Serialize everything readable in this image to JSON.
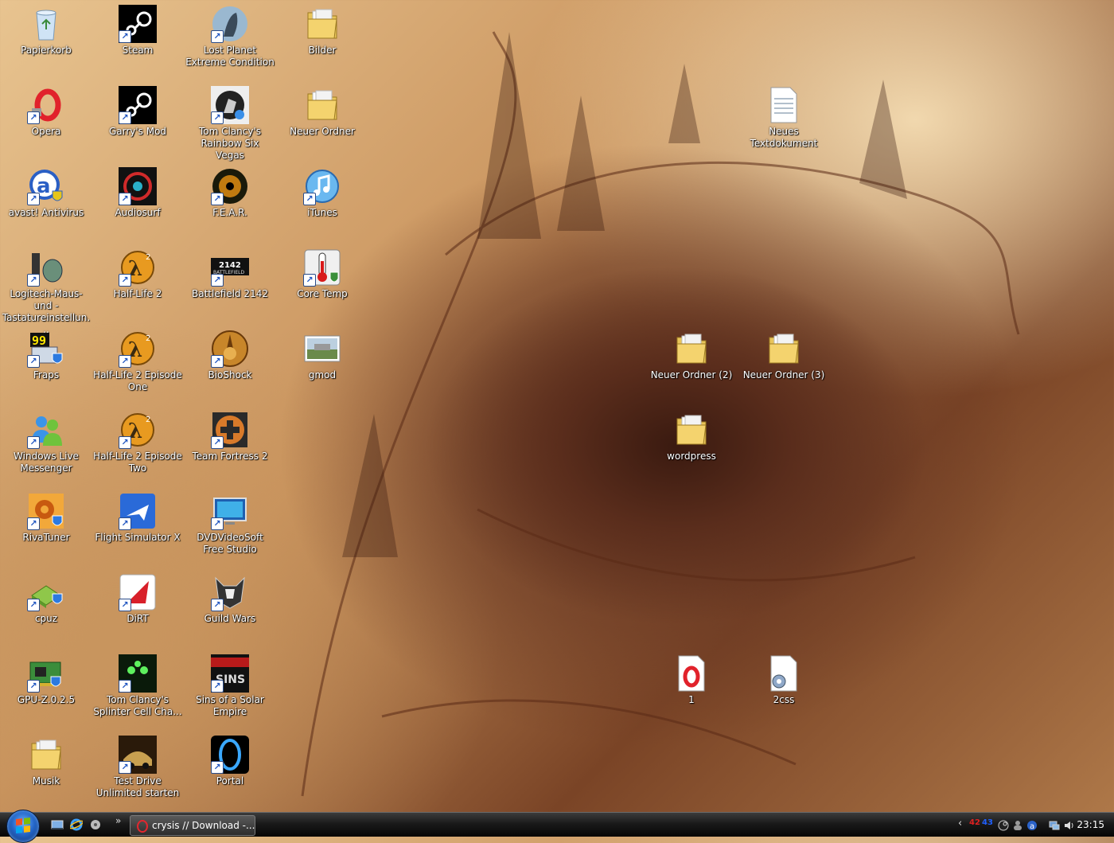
{
  "desktop": {
    "col1": [
      {
        "label": "Papierkorb",
        "icon": "recycle-bin-icon",
        "shortcut": false
      },
      {
        "label": "Opera",
        "icon": "opera-icon",
        "shortcut": true
      },
      {
        "label": "avast! Antivirus",
        "icon": "avast-icon",
        "shortcut": true
      },
      {
        "label": "Logitech-Maus- und -Tastatureinstellun...",
        "icon": "logitech-icon",
        "shortcut": true
      },
      {
        "label": "Fraps",
        "icon": "fraps-icon",
        "shortcut": true
      },
      {
        "label": "Windows Live Messenger",
        "icon": "messenger-icon",
        "shortcut": true
      },
      {
        "label": "RivaTuner",
        "icon": "rivatuner-icon",
        "shortcut": true
      },
      {
        "label": "cpuz",
        "icon": "cpuz-icon",
        "shortcut": true
      },
      {
        "label": "GPU-Z.0.2.5",
        "icon": "gpuz-icon",
        "shortcut": true
      },
      {
        "label": "Musik",
        "icon": "folder-icon",
        "shortcut": false
      }
    ],
    "col2": [
      {
        "label": "Steam",
        "icon": "steam-icon",
        "shortcut": true
      },
      {
        "label": "Garry's Mod",
        "icon": "steam-icon",
        "shortcut": true
      },
      {
        "label": "Audiosurf",
        "icon": "audiosurf-icon",
        "shortcut": true
      },
      {
        "label": "Half-Life 2",
        "icon": "halflife-icon",
        "shortcut": true
      },
      {
        "label": "Half-Life 2 Episode One",
        "icon": "halflife-icon",
        "shortcut": true
      },
      {
        "label": "Half-Life 2 Episode Two",
        "icon": "halflife-icon",
        "shortcut": true
      },
      {
        "label": "Flight Simulator X",
        "icon": "flightsim-icon",
        "shortcut": true
      },
      {
        "label": "DiRT",
        "icon": "dirt-icon",
        "shortcut": true
      },
      {
        "label": "Tom Clancy's Splinter Cell Cha...",
        "icon": "splintercell-icon",
        "shortcut": true
      },
      {
        "label": "Test Drive Unlimited starten",
        "icon": "testdrive-icon",
        "shortcut": true
      }
    ],
    "col3": [
      {
        "label": "Lost Planet Extreme Condition",
        "icon": "lostplanet-icon",
        "shortcut": true
      },
      {
        "label": "Tom Clancy's Rainbow Six Vegas",
        "icon": "rainbowsix-icon",
        "shortcut": true
      },
      {
        "label": "F.E.A.R.",
        "icon": "fear-icon",
        "shortcut": true
      },
      {
        "label": "Battlefield 2142",
        "icon": "battlefield-icon",
        "shortcut": true
      },
      {
        "label": "BioShock",
        "icon": "bioshock-icon",
        "shortcut": true
      },
      {
        "label": "Team Fortress 2",
        "icon": "tf2-icon",
        "shortcut": true
      },
      {
        "label": "DVDVideoSoft Free Studio",
        "icon": "dvdvideosoft-icon",
        "shortcut": true
      },
      {
        "label": "Guild Wars",
        "icon": "guildwars-icon",
        "shortcut": true
      },
      {
        "label": "Sins of a Solar Empire",
        "icon": "sins-icon",
        "shortcut": true
      },
      {
        "label": "Portal",
        "icon": "portal-icon",
        "shortcut": true
      }
    ],
    "col4": [
      {
        "label": "Bilder",
        "icon": "folder-icon",
        "shortcut": false
      },
      {
        "label": "Neuer Ordner",
        "icon": "folder-icon",
        "shortcut": false
      },
      {
        "label": "iTunes",
        "icon": "itunes-icon",
        "shortcut": true
      },
      {
        "label": "Core Temp",
        "icon": "coretemp-icon",
        "shortcut": true
      },
      {
        "label": "gmod",
        "icon": "gmod-image-icon",
        "shortcut": false
      }
    ],
    "free": [
      {
        "label": "Neues Textdokument",
        "icon": "text-document-icon"
      },
      {
        "label": "Neuer Ordner (2)",
        "icon": "folder-icon"
      },
      {
        "label": "Neuer Ordner (3)",
        "icon": "folder-icon"
      },
      {
        "label": "wordpress",
        "icon": "folder-icon"
      },
      {
        "label": "1",
        "icon": "opera-document-icon"
      },
      {
        "label": "2css",
        "icon": "css-file-icon"
      }
    ]
  },
  "taskbar": {
    "task_label": "crysis // Download -...",
    "more": "»",
    "tray_left": "‹",
    "tray_num1": "42",
    "tray_num2": "43",
    "clock": "23:15"
  }
}
